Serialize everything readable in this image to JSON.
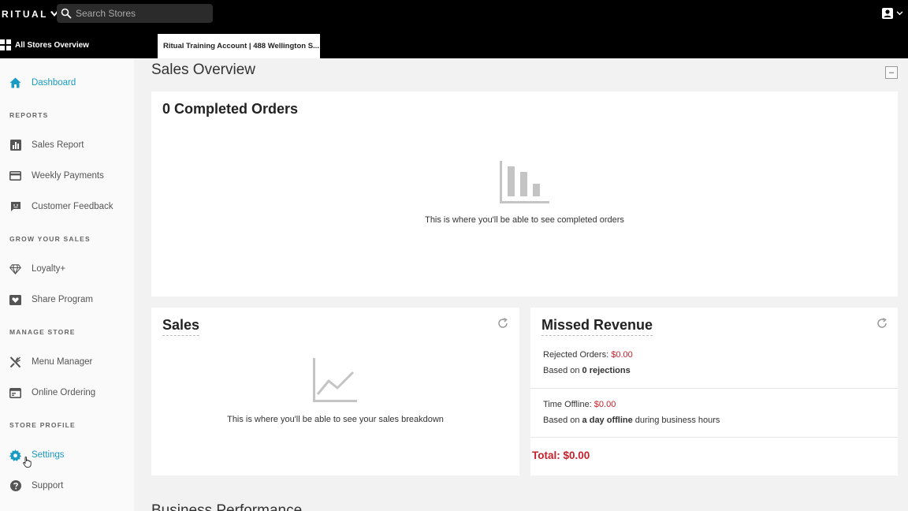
{
  "topbar": {
    "logo": "RITUAL",
    "search_placeholder": "Search Stores"
  },
  "subbar": {
    "stores_overview": "All Stores Overview",
    "store_tab": "Ritual Training Account | 488 Wellington S..."
  },
  "sidebar": {
    "dashboard": "Dashboard",
    "sections": {
      "reports": "REPORTS",
      "grow": "GROW YOUR SALES",
      "manage": "MANAGE STORE",
      "profile": "STORE PROFILE"
    },
    "items": {
      "sales_report": "Sales Report",
      "weekly_payments": "Weekly Payments",
      "customer_feedback": "Customer Feedback",
      "loyalty": "Loyalty+",
      "share_program": "Share Program",
      "menu_manager": "Menu Manager",
      "online_ordering": "Online Ordering",
      "settings": "Settings",
      "support": "Support"
    }
  },
  "main": {
    "title": "Sales Overview",
    "collapse": "–",
    "completed_orders": {
      "title": "0 Completed Orders",
      "empty": "This is where you'll be able to see completed orders"
    },
    "sales": {
      "title": "Sales",
      "empty": "This is where you'll be able to see your sales breakdown"
    },
    "missed_revenue": {
      "title": "Missed Revenue",
      "rejected_label": "Rejected Orders: ",
      "rejected_value": "$0.00",
      "rejected_based_prefix": "Based on ",
      "rejected_based_bold": "0 rejections",
      "offline_label": "Time Offline: ",
      "offline_value": "$0.00",
      "offline_based_prefix": "Based on ",
      "offline_based_bold": "a day offline",
      "offline_based_suffix": " during business hours",
      "total": "Total: $0.00"
    },
    "next_section_title": "Business Performance"
  },
  "colors": {
    "accent": "#1a9bc4",
    "negative": "#c8202b",
    "topbar": "#000000"
  }
}
